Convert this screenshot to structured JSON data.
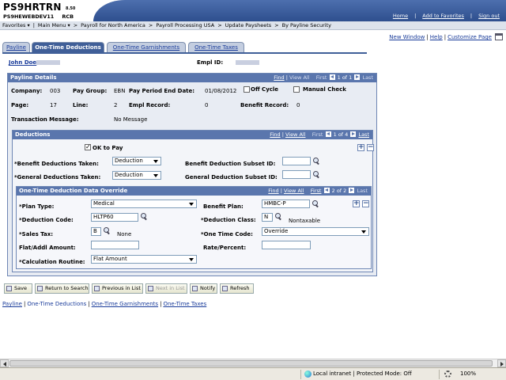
{
  "header": {
    "app_title": "PS9HRTRN",
    "version": "8.50",
    "database": "PS9HEWEBDEV11",
    "region": "RCB",
    "links": [
      "Home",
      "Add to Favorites",
      "Sign out"
    ]
  },
  "breadcrumb": [
    "Favorites",
    "Main Menu",
    "Payroll for North America",
    "Payroll Processing USA",
    "Update Paysheets",
    "By Payline Security"
  ],
  "top_links": [
    "New Window",
    "Help",
    "Customize Page"
  ],
  "tabs": [
    "Payline",
    "One-Time Deductions",
    "One-Time Garnishments",
    "One-Time Taxes"
  ],
  "employee": {
    "name": "John Doe",
    "empl_id_label": "Empl ID:"
  },
  "payline": {
    "title": "Payline Details",
    "nav": {
      "find": "Find",
      "view_all": "View All",
      "first": "First",
      "position": "1 of 1",
      "last": "Last"
    },
    "company_label": "Company:",
    "company": "003",
    "pay_group_label": "Pay Group:",
    "pay_group": "EBN",
    "period_end_label": "Pay Period End Date:",
    "period_end": "01/08/2012",
    "off_cycle_label": "Off Cycle",
    "manual_check_label": "Manual Check",
    "page_label": "Page:",
    "page": "17",
    "line_label": "Line:",
    "line": "2",
    "empl_record_label": "Empl Record:",
    "empl_record": "0",
    "benefit_record_label": "Benefit Record:",
    "benefit_record": "0",
    "transaction_label": "Transaction Message:",
    "transaction": "No Message"
  },
  "deductions": {
    "title": "Deductions",
    "nav": {
      "find": "Find",
      "view_all": "View All",
      "first": "First",
      "position": "1 of 4",
      "last": "Last"
    },
    "ok_to_pay_label": "OK to Pay",
    "benefit_taken_label": "*Benefit Deductions Taken:",
    "benefit_taken": "Deduction",
    "benefit_subset_label": "Benefit Deduction Subset ID:",
    "general_taken_label": "*General Deductions Taken:",
    "general_taken": "Deduction",
    "general_subset_label": "General Deduction Subset ID:"
  },
  "override": {
    "title": "One-Time Deduction Data Override",
    "nav": {
      "find": "Find",
      "view_all": "View All",
      "first": "First",
      "position": "2 of 2",
      "last": "Last"
    },
    "plan_type_label": "*Plan Type:",
    "plan_type": "Medical",
    "benefit_plan_label": "Benefit Plan:",
    "benefit_plan": "HMBC-P",
    "ded_code_label": "*Deduction Code:",
    "ded_code": "HLTP60",
    "ded_class_label": "*Deduction Class:",
    "ded_class": "N",
    "ded_class_desc": "Nontaxable",
    "sales_tax_label": "*Sales Tax:",
    "sales_tax": "B",
    "sales_tax_desc": "None",
    "one_time_code_label": "*One Time Code:",
    "one_time_code": "Override",
    "flat_amount_label": "Flat/Addl Amount:",
    "rate_label": "Rate/Percent:",
    "calc_routine_label": "*Calculation Routine:",
    "calc_routine": "Flat Amount"
  },
  "buttons": [
    "Save",
    "Return to Search",
    "Previous in List",
    "Next in List",
    "Notify",
    "Refresh"
  ],
  "footer_links": [
    "Payline",
    "One-Time Deductions",
    "One-Time Garnishments",
    "One-Time Taxes"
  ],
  "status_bar": {
    "zone": "Local intranet | Protected Mode: Off",
    "zoom": "100%"
  }
}
